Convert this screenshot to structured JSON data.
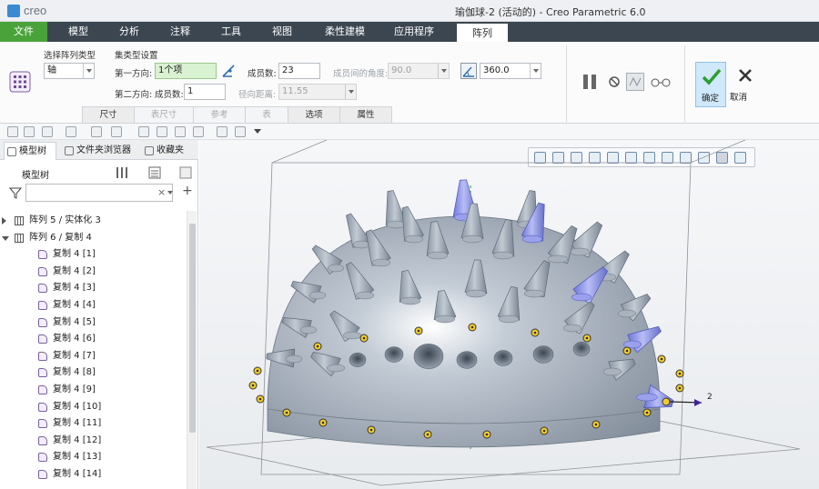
{
  "app": {
    "logo_text": "creo",
    "window_title": "瑜伽球-2 (活动的) - Creo Parametric 6.0"
  },
  "ribbon_tabs": [
    "文件",
    "模型",
    "分析",
    "注释",
    "工具",
    "视图",
    "柔性建模",
    "应用程序",
    "阵列"
  ],
  "ribbon": {
    "pattern_type_label": "选择阵列类型",
    "pattern_type_value": "轴",
    "set_type_label": "集类型设置",
    "dir1_label": "第一方向:",
    "dir1_value": "1个项",
    "members_label": "成员数:",
    "members_value": "23",
    "angle_between_label": "成员间的角度:",
    "angle_between_value": "90.0",
    "total_angle_value": "360.0",
    "dir2_label": "第二方向:",
    "dir2_members_label": "成员数:",
    "dir2_members_value": "1",
    "radial_label": "径向距离:",
    "radial_value": "11.55",
    "subtabs": [
      "尺寸",
      "表尺寸",
      "参考",
      "表",
      "选项",
      "属性"
    ],
    "ok_label": "确定",
    "cancel_label": "取消"
  },
  "panel": {
    "tabs": [
      "模型树",
      "文件夹浏览器",
      "收藏夹"
    ],
    "tree_header": "模型树",
    "search_placeholder": "",
    "items": [
      {
        "label": "阵列 5 / 实体化 3",
        "kind": "pattern",
        "expand": "collapsed",
        "indent": 0
      },
      {
        "label": "阵列 6 / 复制 4",
        "kind": "pattern",
        "expand": "expanded",
        "indent": 0
      },
      {
        "label": "复制 4 [1]",
        "kind": "copy",
        "indent": 1
      },
      {
        "label": "复制 4 [2]",
        "kind": "copy",
        "indent": 1
      },
      {
        "label": "复制 4 [3]",
        "kind": "copy",
        "indent": 1
      },
      {
        "label": "复制 4 [4]",
        "kind": "copy",
        "indent": 1
      },
      {
        "label": "复制 4 [5]",
        "kind": "copy",
        "indent": 1
      },
      {
        "label": "复制 4 [6]",
        "kind": "copy",
        "indent": 1
      },
      {
        "label": "复制 4 [7]",
        "kind": "copy",
        "indent": 1
      },
      {
        "label": "复制 4 [8]",
        "kind": "copy",
        "indent": 1
      },
      {
        "label": "复制 4 [9]",
        "kind": "copy",
        "indent": 1
      },
      {
        "label": "复制 4 [10]",
        "kind": "copy",
        "indent": 1
      },
      {
        "label": "复制 4 [11]",
        "kind": "copy",
        "indent": 1
      },
      {
        "label": "复制 4 [12]",
        "kind": "copy",
        "indent": 1
      },
      {
        "label": "复制 4 [13]",
        "kind": "copy",
        "indent": 1
      },
      {
        "label": "复制 4 [14]",
        "kind": "copy",
        "indent": 1
      }
    ]
  },
  "graphics": {
    "dimension_label": "2"
  },
  "colors": {
    "file_tab": "#4aa33a",
    "ribbon_bar": "#3c4650",
    "selected_spike": "#8b93e6",
    "model_grey": "#9ea8b4"
  }
}
